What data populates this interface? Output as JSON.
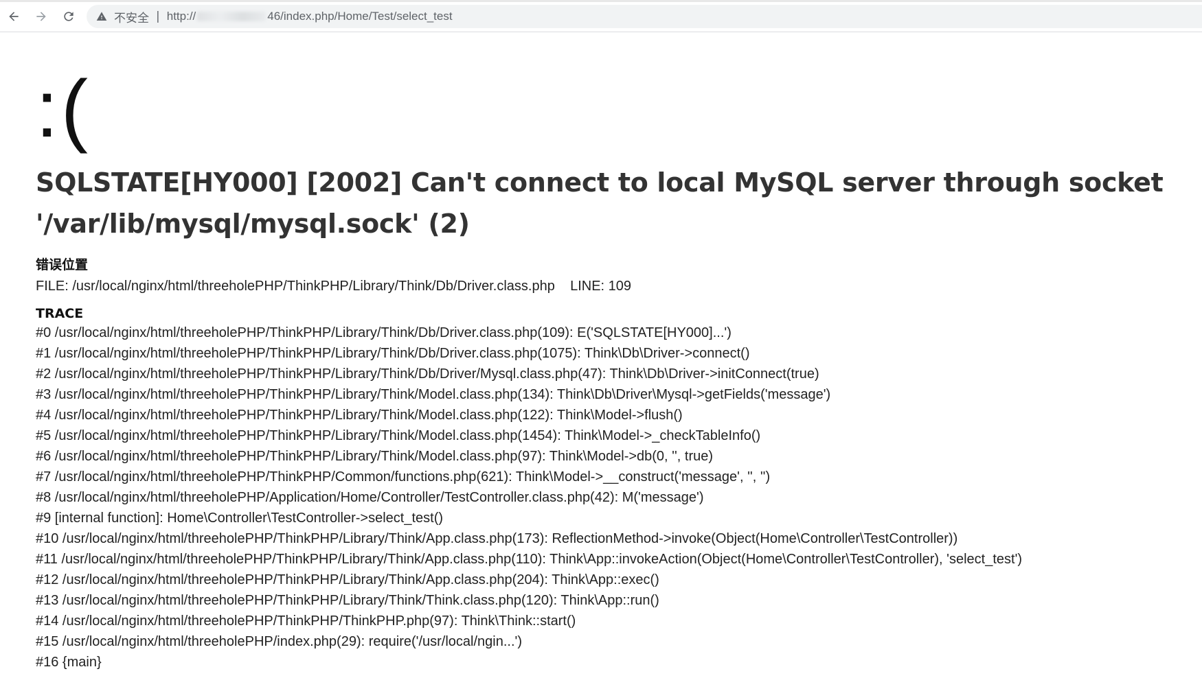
{
  "browser": {
    "security_label": "不安全",
    "url_prefix": "http://",
    "url_suffix": "46/index.php/Home/Test/select_test"
  },
  "error": {
    "face": ":(",
    "message": "SQLSTATE[HY000] [2002] Can't connect to local MySQL server through socket '/var/lib/mysql/mysql.sock' (2)",
    "location_title": "错误位置",
    "file_line": "FILE: /usr/local/nginx/html/threeholePHP/ThinkPHP/Library/Think/Db/Driver.class.php    LINE: 109",
    "trace_title": "TRACE",
    "trace": [
      "#0 /usr/local/nginx/html/threeholePHP/ThinkPHP/Library/Think/Db/Driver.class.php(109): E('SQLSTATE[HY000]...')",
      "#1 /usr/local/nginx/html/threeholePHP/ThinkPHP/Library/Think/Db/Driver.class.php(1075): Think\\Db\\Driver->connect()",
      "#2 /usr/local/nginx/html/threeholePHP/ThinkPHP/Library/Think/Db/Driver/Mysql.class.php(47): Think\\Db\\Driver->initConnect(true)",
      "#3 /usr/local/nginx/html/threeholePHP/ThinkPHP/Library/Think/Model.class.php(134): Think\\Db\\Driver\\Mysql->getFields('message')",
      "#4 /usr/local/nginx/html/threeholePHP/ThinkPHP/Library/Think/Model.class.php(122): Think\\Model->flush()",
      "#5 /usr/local/nginx/html/threeholePHP/ThinkPHP/Library/Think/Model.class.php(1454): Think\\Model->_checkTableInfo()",
      "#6 /usr/local/nginx/html/threeholePHP/ThinkPHP/Library/Think/Model.class.php(97): Think\\Model->db(0, '', true)",
      "#7 /usr/local/nginx/html/threeholePHP/ThinkPHP/Common/functions.php(621): Think\\Model->__construct('message', '', '')",
      "#8 /usr/local/nginx/html/threeholePHP/Application/Home/Controller/TestController.class.php(42): M('message')",
      "#9 [internal function]: Home\\Controller\\TestController->select_test()",
      "#10 /usr/local/nginx/html/threeholePHP/ThinkPHP/Library/Think/App.class.php(173): ReflectionMethod->invoke(Object(Home\\Controller\\TestController))",
      "#11 /usr/local/nginx/html/threeholePHP/ThinkPHP/Library/Think/App.class.php(110): Think\\App::invokeAction(Object(Home\\Controller\\TestController), 'select_test')",
      "#12 /usr/local/nginx/html/threeholePHP/ThinkPHP/Library/Think/App.class.php(204): Think\\App::exec()",
      "#13 /usr/local/nginx/html/threeholePHP/ThinkPHP/Library/Think/Think.class.php(120): Think\\App::run()",
      "#14 /usr/local/nginx/html/threeholePHP/ThinkPHP/ThinkPHP.php(97): Think\\Think::start()",
      "#15 /usr/local/nginx/html/threeholePHP/index.php(29): require('/usr/local/ngin...')",
      "#16 {main}"
    ]
  }
}
